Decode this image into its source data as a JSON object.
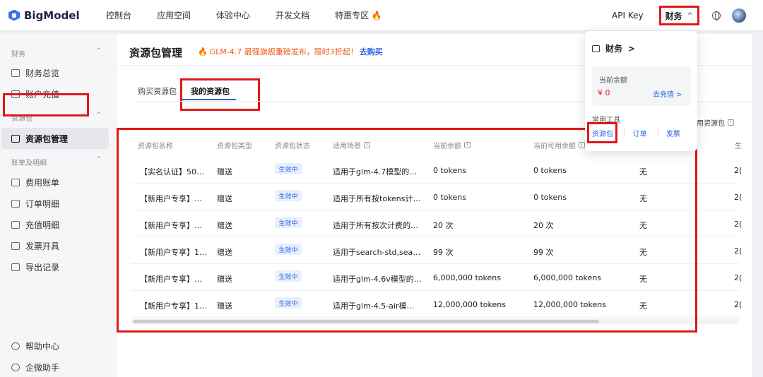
{
  "topnav": {
    "brand": "BigModel",
    "links": [
      "控制台",
      "应用空间",
      "体验中心",
      "开发文档",
      "特惠专区 🔥"
    ],
    "api_key": "API Key",
    "finance": "财务",
    "finance_chevron": "^"
  },
  "sidebar": {
    "group_finance": "财务",
    "finance_overview": "财务总览",
    "account_topup": "账户充值",
    "group_packages": "资源包",
    "package_manage": "资源包管理",
    "group_bills": "账单及明细",
    "expense_bill": "费用账单",
    "order_detail": "订单明细",
    "topup_detail": "充值明细",
    "invoice": "发票开具",
    "export_records": "导出记录",
    "help_center": "帮助中心",
    "wecom_assistant": "企微助手"
  },
  "main": {
    "title": "资源包管理",
    "promo": "GLM-4.7 最强旗舰重磅发布，限时3折起！",
    "promo_link": "去购买",
    "tab_buy": "购买资源包",
    "tab_mine": "我的资源包",
    "filter_available": "用资源包"
  },
  "table": {
    "headers": [
      "资源包名称",
      "资源包类型",
      "资源包状态",
      "适用场景",
      "当前余额",
      "当前可用余额",
      "生"
    ],
    "rows": [
      {
        "name": "【实名认证】50…",
        "type": "赠送",
        "status": "生效中",
        "scene": "适用于glm-4.7模型的…",
        "balance": "0 tokens",
        "available": "0 tokens",
        "expiry": "无",
        "extra": "2("
      },
      {
        "name": "【新用户专享】…",
        "type": "赠送",
        "status": "生效中",
        "scene": "适用于所有按tokens计…",
        "balance": "0 tokens",
        "available": "0 tokens",
        "expiry": "无",
        "extra": "2("
      },
      {
        "name": "【新用户专享】…",
        "type": "赠送",
        "status": "生效中",
        "scene": "适用于所有按次计费的…",
        "balance": "20 次",
        "available": "20 次",
        "expiry": "无",
        "extra": "2("
      },
      {
        "name": "【新用户专享】1…",
        "type": "赠送",
        "status": "生效中",
        "scene": "适用于search-std,sea…",
        "balance": "99 次",
        "available": "99 次",
        "expiry": "无",
        "extra": "2("
      },
      {
        "name": "【新用户专享】…",
        "type": "赠送",
        "status": "生效中",
        "scene": "适用于glm-4.6v模型的…",
        "balance": "6,000,000 tokens",
        "available": "6,000,000 tokens",
        "expiry": "无",
        "extra": "2("
      },
      {
        "name": "【新用户专享】1…",
        "type": "赠送",
        "status": "生效中",
        "scene": "适用于glm-4.5-air模…",
        "balance": "12,000,000 tokens",
        "available": "12,000,000 tokens",
        "expiry": "无",
        "extra": "2("
      }
    ]
  },
  "dropdown": {
    "title": "财务",
    "balance_label": "当前余额",
    "balance_value": "¥ 0",
    "topup": "去充值 >",
    "tools_label": "常用工具",
    "link_packages": "资源包",
    "link_orders": "订单",
    "link_invoice": "发票"
  }
}
